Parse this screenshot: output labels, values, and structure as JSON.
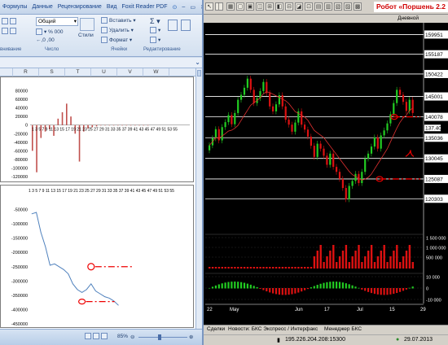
{
  "excel": {
    "tabs": [
      "Формулы",
      "Данные",
      "Рецензирование",
      "Вид",
      "Foxit Reader PDF"
    ],
    "number_format": "Общий",
    "buttons": {
      "insert": "Вставить",
      "delete": "Удалить",
      "format": "Формат",
      "styles": "Стили"
    },
    "groups": {
      "alignment": "внивание",
      "number": "Число",
      "cells": "Ячейки",
      "editing": "Редактирование"
    },
    "columns": [
      "R",
      "S",
      "T",
      "U",
      "V",
      "W"
    ],
    "zoom": "85%"
  },
  "chart_data": [
    {
      "type": "bar",
      "title": "",
      "categories": [
        "1",
        "3",
        "5",
        "7",
        "9",
        "11",
        "13",
        "15",
        "17",
        "19",
        "21",
        "23",
        "25",
        "27",
        "29",
        "31",
        "33",
        "35",
        "37",
        "39",
        "41",
        "43",
        "45",
        "47",
        "49",
        "51",
        "53",
        "55"
      ],
      "ylim": [
        -120000,
        100000
      ],
      "yticks": [
        80000,
        60000,
        40000,
        20000,
        0,
        -20000,
        -40000,
        -60000,
        -80000,
        -100000,
        -120000
      ],
      "values": [
        -60000,
        -110000,
        -30000,
        -15000,
        -10000,
        -25000,
        15000,
        30000,
        50000,
        20000,
        -20000,
        -85000,
        -15000,
        -8000,
        -5000,
        -3000,
        0,
        0,
        0,
        0,
        0,
        0,
        0,
        0,
        0,
        0,
        0,
        0
      ],
      "x_tick_text": "1 3 5 7 9 11 13 15 17 19 21 23 25 27 29 31 33 35 37 39 41 43 45 47 49 51 53 55",
      "color": "#c0504d"
    },
    {
      "type": "line",
      "title": "",
      "ylim": [
        -450000,
        0
      ],
      "yticks": [
        -50000,
        -100000,
        -150000,
        -200000,
        -250000,
        -300000,
        -350000,
        -400000,
        -450000
      ],
      "x_tick_text": "1 3 5 7 9 11 13 15 17 19 21 23 25 27 29 31 33 35 37 39 41 43 45 47 49 51 53 55",
      "values": [
        -65000,
        -60000,
        -130000,
        -180000,
        -245000,
        -240000,
        -250000,
        -260000,
        -275000,
        -310000,
        -330000,
        -340000,
        -330000,
        -310000,
        -335000,
        -345000,
        -355000,
        -360000,
        -370000,
        -385000
      ],
      "color": "#4f81bd"
    }
  ],
  "terminal": {
    "robot_title": "Робот «Поршень 2.2",
    "period": "Дневной",
    "prices": [
      "159951",
      "155187",
      "150422",
      "145001",
      "140078",
      "135036",
      "130045",
      "125087",
      "120303"
    ],
    "current_price": "137.40",
    "volume_labels": [
      "1 500 000",
      "1 000 000",
      "500 000"
    ],
    "osc_labels": [
      "10 000",
      "0",
      "-10 000"
    ],
    "date_labels": [
      "22",
      "May",
      "Jun",
      "17",
      "Jul",
      "15",
      "29"
    ],
    "tabs": [
      "Сделки",
      "Новости: БКС Экспресс / Интерфакс",
      "Менеджер БКС"
    ],
    "ip": "195.226.204.208:15300",
    "date": "29.07.2013"
  }
}
